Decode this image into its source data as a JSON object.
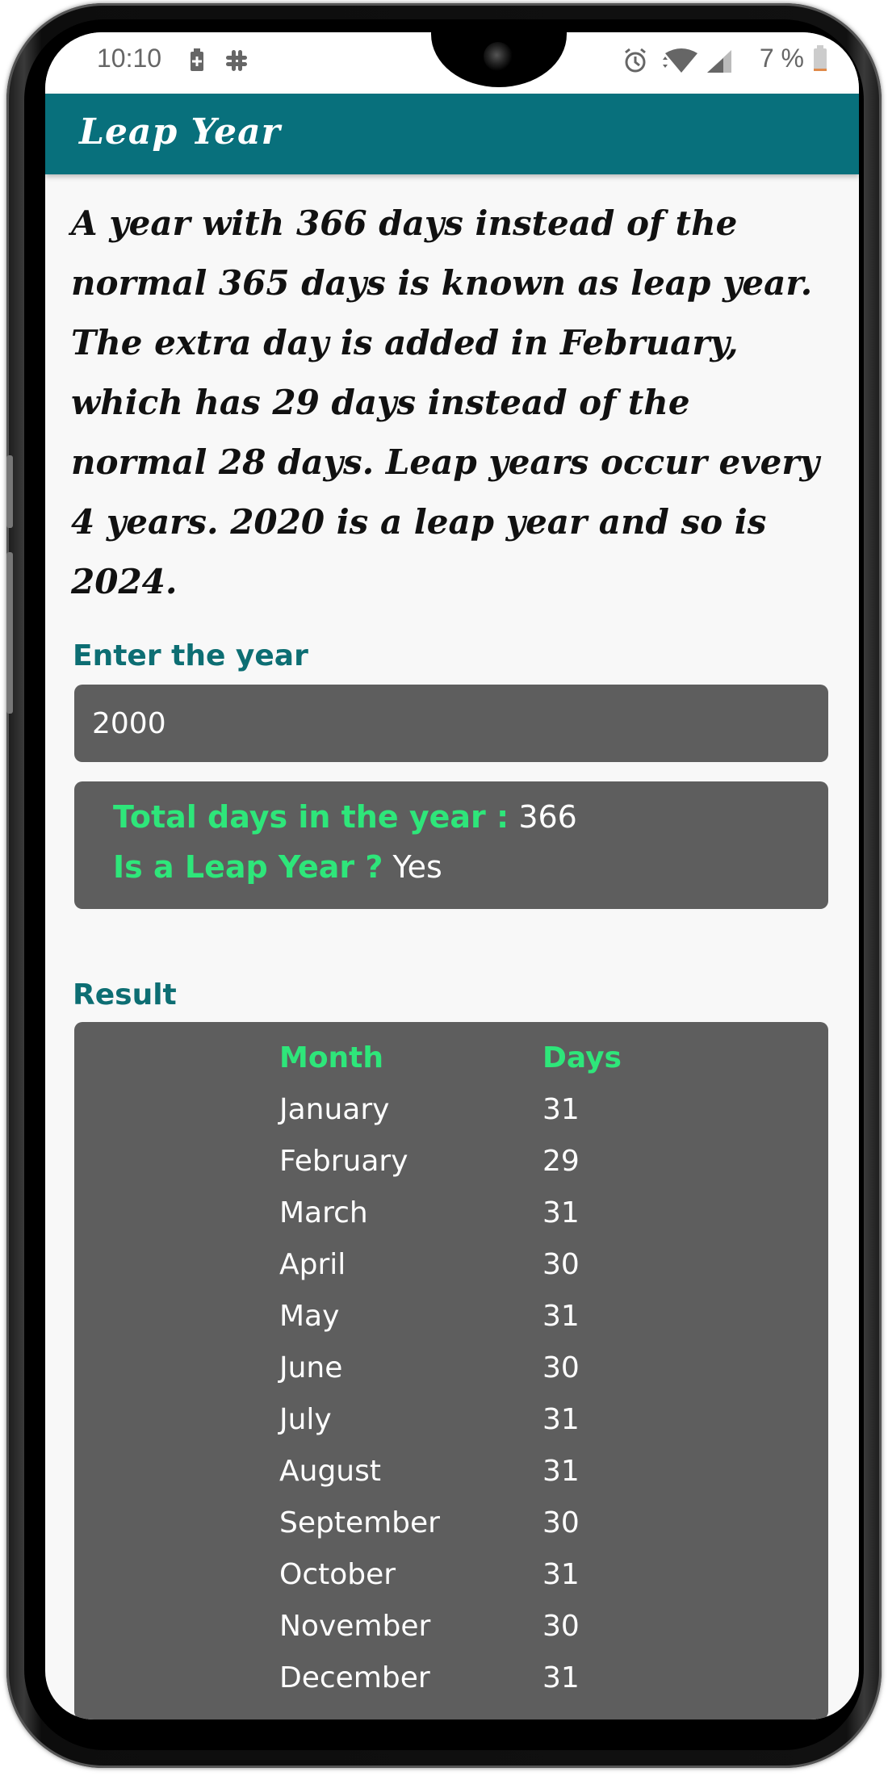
{
  "status_bar": {
    "time": "10:10",
    "left_icons": [
      "battery-saver-icon",
      "slack-icon"
    ],
    "right_icons": [
      "alarm-icon",
      "wifi-icon",
      "signal-icon",
      "battery-icon"
    ],
    "battery_percent": "7 %"
  },
  "app_bar": {
    "title": "Leap Year",
    "color": "#08707c"
  },
  "intro": {
    "text": "A year with 366 days instead of the normal 365 days is known as leap year. The extra day is added in February, which has 29 days instead of the normal 28 days. Leap years occur every 4 years. 2020 is a leap year and so is 2024."
  },
  "year_field": {
    "label": "Enter the year",
    "value": "2000"
  },
  "summary": {
    "total_days_label": "Total days in the year :",
    "total_days_value": "366",
    "is_leap_label": "Is a Leap Year ?",
    "is_leap_value": "Yes"
  },
  "result": {
    "label": "Result",
    "columns": [
      "Month",
      "Days"
    ],
    "rows": [
      {
        "month": "January",
        "days": "31"
      },
      {
        "month": "February",
        "days": "29"
      },
      {
        "month": "March",
        "days": "31"
      },
      {
        "month": "April",
        "days": "30"
      },
      {
        "month": "May",
        "days": "31"
      },
      {
        "month": "June",
        "days": "30"
      },
      {
        "month": "July",
        "days": "31"
      },
      {
        "month": "August",
        "days": "31"
      },
      {
        "month": "September",
        "days": "30"
      },
      {
        "month": "October",
        "days": "31"
      },
      {
        "month": "November",
        "days": "30"
      },
      {
        "month": "December",
        "days": "31"
      }
    ]
  },
  "colors": {
    "accent_teal": "#0d6e73",
    "highlight_green": "#2ee67a",
    "card_gray": "#5e5e5e"
  }
}
